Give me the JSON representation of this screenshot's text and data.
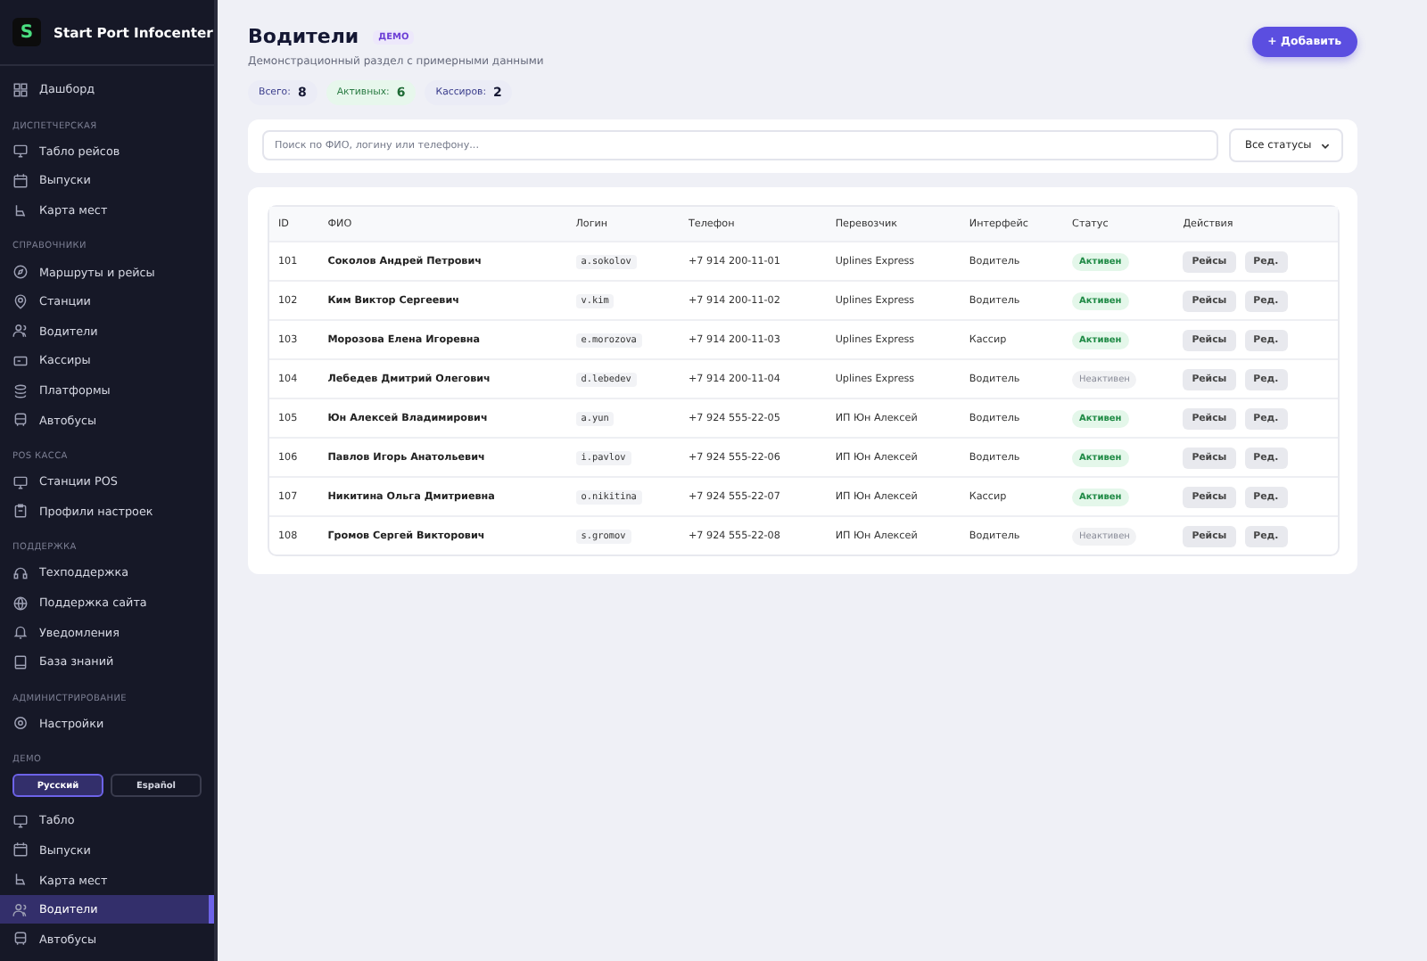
{
  "sidebar": {
    "logo_letter": "S",
    "title": "Start Port Infocenter",
    "sections": [
      {
        "items": [
          {
            "label": "Дашборд",
            "selected": false
          }
        ]
      },
      {
        "heading": "ДИСПЕТЧЕРСКАЯ",
        "items": [
          {
            "label": "Табло рейсов",
            "selected": false
          },
          {
            "label": "Выпуски",
            "selected": false
          },
          {
            "label": "Карта мест",
            "selected": false
          }
        ]
      },
      {
        "heading": "СПРАВОЧНИКИ",
        "items": [
          {
            "label": "Маршруты и рейсы",
            "selected": false
          },
          {
            "label": "Станции",
            "selected": false
          },
          {
            "label": "Водители",
            "selected": false
          },
          {
            "label": "Кассиры",
            "selected": false
          },
          {
            "label": "Платформы",
            "selected": false
          },
          {
            "label": "Автобусы",
            "selected": false
          }
        ]
      },
      {
        "heading": "POS КАССА",
        "items": [
          {
            "label": "Станции POS",
            "selected": false
          },
          {
            "label": "Профили настроек",
            "selected": false
          }
        ]
      },
      {
        "heading": "ПОДДЕРЖКА",
        "items": [
          {
            "label": "Техподдержка",
            "selected": false
          },
          {
            "label": "Поддержка сайта",
            "selected": false
          },
          {
            "label": "Уведомления",
            "selected": false
          },
          {
            "label": "База знаний",
            "selected": false
          }
        ]
      },
      {
        "heading": "АДМИНИСТРИРОВАНИЕ",
        "items": [
          {
            "label": "Настройки",
            "selected": false
          }
        ]
      },
      {
        "heading": "ДЕМО",
        "languages": [
          {
            "label": "Русский",
            "selected": true
          },
          {
            "label": "Español",
            "selected": false
          }
        ],
        "items": [
          {
            "label": "Табло",
            "selected": false
          },
          {
            "label": "Выпуски",
            "selected": false
          },
          {
            "label": "Карта мест",
            "selected": false
          },
          {
            "label": "Водители",
            "selected": true
          },
          {
            "label": "Автобусы",
            "selected": false
          }
        ]
      }
    ]
  },
  "page": {
    "title": "Водители",
    "badge": "ДЕМО",
    "subtitle": "Демонстрационный раздел с примерными данными",
    "add_button": "+ Добавить",
    "stats": [
      {
        "label": "Всего:",
        "value": "8",
        "kind": "neutral"
      },
      {
        "label": "Активных:",
        "value": "6",
        "kind": "positive"
      },
      {
        "label": "Кассиров:",
        "value": "2",
        "kind": "neutral"
      }
    ]
  },
  "filters": {
    "search": {
      "placeholder": "Поиск по ФИО, логину или телефону..."
    },
    "status_select": "Все статусы"
  },
  "table": {
    "columns": [
      "ID",
      "ФИО",
      "Логин",
      "Телефон",
      "Перевозчик",
      "Интерфейс",
      "Статус",
      "Действия"
    ],
    "rows": [
      {
        "id": "101",
        "name": "Соколов Андрей Петрович",
        "login": "a.sokolov",
        "phone": "+7 914 200-11-01",
        "carrier": "Uplines Express",
        "interface": "Водитель",
        "status": "Активен",
        "active": true,
        "actions": [
          "Рейсы",
          "Ред."
        ]
      },
      {
        "id": "102",
        "name": "Ким Виктор Сергеевич",
        "login": "v.kim",
        "phone": "+7 914 200-11-02",
        "carrier": "Uplines Express",
        "interface": "Водитель",
        "status": "Активен",
        "active": true,
        "actions": [
          "Рейсы",
          "Ред."
        ]
      },
      {
        "id": "103",
        "name": "Морозова Елена Игоревна",
        "login": "e.morozova",
        "phone": "+7 914 200-11-03",
        "carrier": "Uplines Express",
        "interface": "Кассир",
        "status": "Активен",
        "active": true,
        "actions": [
          "Рейсы",
          "Ред."
        ]
      },
      {
        "id": "104",
        "name": "Лебедев Дмитрий Олегович",
        "login": "d.lebedev",
        "phone": "+7 914 200-11-04",
        "carrier": "Uplines Express",
        "interface": "Водитель",
        "status": "Неактивен",
        "active": false,
        "actions": [
          "Рейсы",
          "Ред."
        ]
      },
      {
        "id": "105",
        "name": "Юн Алексей Владимирович",
        "login": "a.yun",
        "phone": "+7 924 555-22-05",
        "carrier": "ИП Юн Алексей",
        "interface": "Водитель",
        "status": "Активен",
        "active": true,
        "actions": [
          "Рейсы",
          "Ред."
        ]
      },
      {
        "id": "106",
        "name": "Павлов Игорь Анатольевич",
        "login": "i.pavlov",
        "phone": "+7 924 555-22-06",
        "carrier": "ИП Юн Алексей",
        "interface": "Водитель",
        "status": "Активен",
        "active": true,
        "actions": [
          "Рейсы",
          "Ред."
        ]
      },
      {
        "id": "107",
        "name": "Никитина Ольга Дмитриевна",
        "login": "o.nikitina",
        "phone": "+7 924 555-22-07",
        "carrier": "ИП Юн Алексей",
        "interface": "Кассир",
        "status": "Активен",
        "active": true,
        "actions": [
          "Рейсы",
          "Ред."
        ]
      },
      {
        "id": "108",
        "name": "Громов Сергей Викторович",
        "login": "s.gromov",
        "phone": "+7 924 555-22-08",
        "carrier": "ИП Юн Алексей",
        "interface": "Водитель",
        "status": "Неактивен",
        "active": false,
        "actions": [
          "Рейсы",
          "Ред."
        ]
      }
    ]
  }
}
